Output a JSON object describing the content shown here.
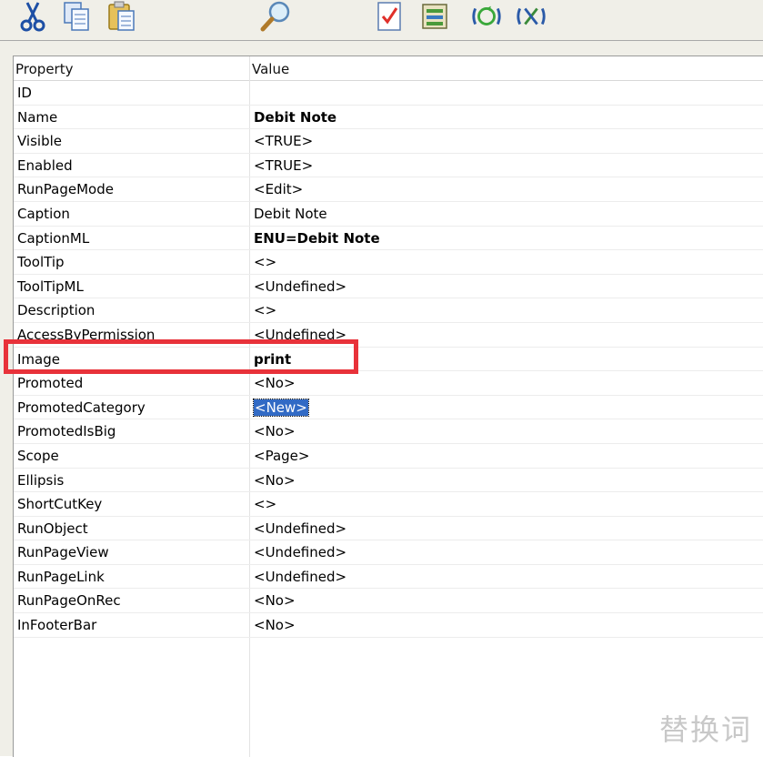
{
  "toolbar": {
    "buttons": [
      {
        "name": "cut-icon"
      },
      {
        "name": "copy-icon"
      },
      {
        "name": "paste-icon"
      },
      {
        "name": "find-icon"
      },
      {
        "name": "checklist-icon"
      },
      {
        "name": "properties-icon"
      },
      {
        "name": "refresh-icon"
      },
      {
        "name": "tools-icon"
      }
    ]
  },
  "grid": {
    "header": {
      "property": "Property",
      "value": "Value"
    },
    "rows": [
      {
        "property": "ID",
        "value": ""
      },
      {
        "property": "Name",
        "value": "Debit Note"
      },
      {
        "property": "Visible",
        "value": "<TRUE>"
      },
      {
        "property": "Enabled",
        "value": "<TRUE>"
      },
      {
        "property": "RunPageMode",
        "value": "<Edit>"
      },
      {
        "property": "Caption",
        "value": "Debit Note"
      },
      {
        "property": "CaptionML",
        "value": "ENU=Debit Note"
      },
      {
        "property": "ToolTip",
        "value": "<>"
      },
      {
        "property": "ToolTipML",
        "value": "<Undefined>"
      },
      {
        "property": "Description",
        "value": "<>"
      },
      {
        "property": "AccessByPermission",
        "value": "<Undefined>"
      },
      {
        "property": "Image",
        "value": "print"
      },
      {
        "property": "Promoted",
        "value": "<No>"
      },
      {
        "property": "PromotedCategory",
        "value": "<New>"
      },
      {
        "property": "PromotedIsBig",
        "value": "<No>"
      },
      {
        "property": "Scope",
        "value": "<Page>"
      },
      {
        "property": "Ellipsis",
        "value": "<No>"
      },
      {
        "property": "ShortCutKey",
        "value": "<>"
      },
      {
        "property": "RunObject",
        "value": "<Undefined>"
      },
      {
        "property": "RunPageView",
        "value": "<Undefined>"
      },
      {
        "property": "RunPageLink",
        "value": "<Undefined>"
      },
      {
        "property": "RunPageOnRec",
        "value": "<No>"
      },
      {
        "property": "InFooterBar",
        "value": "<No>"
      }
    ]
  },
  "watermark": "替换词",
  "colors": {
    "highlight": "#e8323a",
    "selection": "#316ac5"
  }
}
